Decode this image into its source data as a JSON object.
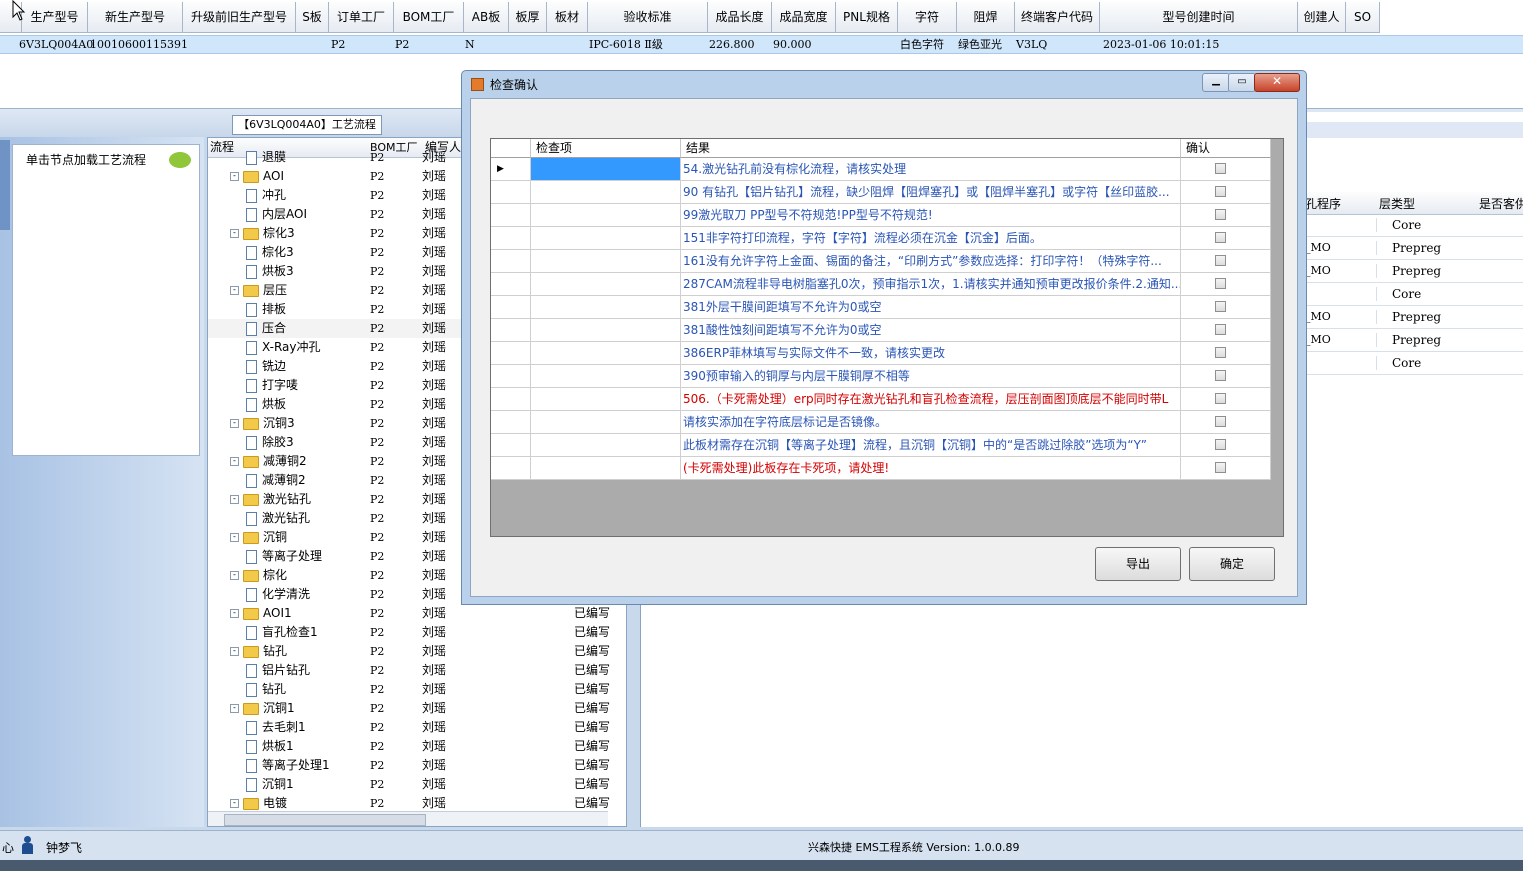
{
  "top_grid": {
    "headers": [
      "生产型号",
      "新生产型号",
      "升级前旧生产型号",
      "S板",
      "订单工厂",
      "BOM工厂",
      "AB板",
      "板厚",
      "板材",
      "验收标准",
      "成品长度",
      "成品宽度",
      "PNL规格",
      "字符",
      "阻焊",
      "终端客户代码",
      "型号创建时间",
      "创建人",
      "SO"
    ],
    "row": {
      "生产型号": "6V3LQ004A0",
      "新生产型号": "10010600115391",
      "订单工厂": "P2",
      "BOM工厂": "P2",
      "AB板": "N",
      "验收标准": "IPC-6018 Ⅱ级",
      "成品长度": "226.800",
      "成品宽度": "90.000",
      "字符": "白色字符",
      "阻焊": "绿色亚光",
      "终端客户代码": "V3LQ",
      "型号创建时间": "2023-01-06 10:01:15"
    }
  },
  "process_title": "【6V3LQ004A0】工艺流程",
  "left_panel": {
    "node_hint": "单击节点加载工艺流程"
  },
  "tree": {
    "headers": [
      "流程",
      "BOM工厂",
      "编写人"
    ],
    "rows": [
      {
        "type": "doc",
        "name": "退膜",
        "factory": "P2",
        "writer": "刘瑶",
        "status": ""
      },
      {
        "type": "folder",
        "name": "AOI",
        "factory": "P2",
        "writer": "刘瑶",
        "status": ""
      },
      {
        "type": "doc",
        "name": "冲孔",
        "factory": "P2",
        "writer": "刘瑶",
        "status": ""
      },
      {
        "type": "doc",
        "name": "内层AOI",
        "factory": "P2",
        "writer": "刘瑶",
        "status": ""
      },
      {
        "type": "folder",
        "name": "棕化3",
        "factory": "P2",
        "writer": "刘瑶",
        "status": ""
      },
      {
        "type": "doc",
        "name": "棕化3",
        "factory": "P2",
        "writer": "刘瑶",
        "status": ""
      },
      {
        "type": "doc",
        "name": "烘板3",
        "factory": "P2",
        "writer": "刘瑶",
        "status": ""
      },
      {
        "type": "folder",
        "name": "层压",
        "factory": "P2",
        "writer": "刘瑶",
        "status": ""
      },
      {
        "type": "doc",
        "name": "排板",
        "factory": "P2",
        "writer": "刘瑶",
        "status": ""
      },
      {
        "type": "doc",
        "name": "压合",
        "factory": "P2",
        "writer": "刘瑶",
        "status": ""
      },
      {
        "type": "doc",
        "name": "X-Ray冲孔",
        "factory": "P2",
        "writer": "刘瑶",
        "status": ""
      },
      {
        "type": "doc",
        "name": "铣边",
        "factory": "P2",
        "writer": "刘瑶",
        "status": ""
      },
      {
        "type": "doc",
        "name": "打字唛",
        "factory": "P2",
        "writer": "刘瑶",
        "status": ""
      },
      {
        "type": "doc",
        "name": "烘板",
        "factory": "P2",
        "writer": "刘瑶",
        "status": ""
      },
      {
        "type": "folder",
        "name": "沉铜3",
        "factory": "P2",
        "writer": "刘瑶",
        "status": ""
      },
      {
        "type": "doc",
        "name": "除胶3",
        "factory": "P2",
        "writer": "刘瑶",
        "status": ""
      },
      {
        "type": "folder",
        "name": "减薄铜2",
        "factory": "P2",
        "writer": "刘瑶",
        "status": ""
      },
      {
        "type": "doc",
        "name": "减薄铜2",
        "factory": "P2",
        "writer": "刘瑶",
        "status": ""
      },
      {
        "type": "folder",
        "name": "激光钻孔",
        "factory": "P2",
        "writer": "刘瑶",
        "status": ""
      },
      {
        "type": "doc",
        "name": "激光钻孔",
        "factory": "P2",
        "writer": "刘瑶",
        "status": ""
      },
      {
        "type": "folder",
        "name": "沉铜",
        "factory": "P2",
        "writer": "刘瑶",
        "status": ""
      },
      {
        "type": "doc",
        "name": "等离子处理",
        "factory": "P2",
        "writer": "刘瑶",
        "status": ""
      },
      {
        "type": "folder",
        "name": "棕化",
        "factory": "P2",
        "writer": "刘瑶",
        "status": ""
      },
      {
        "type": "doc",
        "name": "化学清洗",
        "factory": "P2",
        "writer": "刘瑶",
        "status": ""
      },
      {
        "type": "folder",
        "name": "AOI1",
        "factory": "P2",
        "writer": "刘瑶",
        "status": "已编写"
      },
      {
        "type": "doc",
        "name": "盲孔检查1",
        "factory": "P2",
        "writer": "刘瑶",
        "status": "已编写"
      },
      {
        "type": "folder",
        "name": "钻孔",
        "factory": "P2",
        "writer": "刘瑶",
        "status": "已编写"
      },
      {
        "type": "doc",
        "name": "铝片钻孔",
        "factory": "P2",
        "writer": "刘瑶",
        "status": "已编写"
      },
      {
        "type": "doc",
        "name": "钻孔",
        "factory": "P2",
        "writer": "刘瑶",
        "status": "已编写"
      },
      {
        "type": "folder",
        "name": "沉铜1",
        "factory": "P2",
        "writer": "刘瑶",
        "status": "已编写"
      },
      {
        "type": "doc",
        "name": "去毛刺1",
        "factory": "P2",
        "writer": "刘瑶",
        "status": "已编写"
      },
      {
        "type": "doc",
        "name": "烘板1",
        "factory": "P2",
        "writer": "刘瑶",
        "status": "已编写"
      },
      {
        "type": "doc",
        "name": "等离子处理1",
        "factory": "P2",
        "writer": "刘瑶",
        "status": "已编写"
      },
      {
        "type": "doc",
        "name": "沉铜1",
        "factory": "P2",
        "writer": "刘瑶",
        "status": "已编写"
      },
      {
        "type": "folder",
        "name": "电镀",
        "factory": "P2",
        "writer": "刘瑶",
        "status": "已编写"
      }
    ]
  },
  "right_grid": {
    "headers": [
      "孔程序",
      "层类型",
      "是否客供"
    ],
    "rows": [
      {
        "prog": "",
        "layer": "Core"
      },
      {
        "prog": "_MO",
        "layer": "Prepreg"
      },
      {
        "prog": "_MO",
        "layer": "Prepreg"
      },
      {
        "prog": "",
        "layer": "Core"
      },
      {
        "prog": "_MO",
        "layer": "Prepreg"
      },
      {
        "prog": "_MO",
        "layer": "Prepreg"
      },
      {
        "prog": "",
        "layer": "Core"
      }
    ]
  },
  "dialog": {
    "title": "检查确认",
    "headers": [
      "检查项",
      "结果",
      "确认"
    ],
    "rows": [
      {
        "result": "54.激光钻孔前没有棕化流程，请核实处理",
        "red": false
      },
      {
        "result": "90 有钻孔【铝片钻孔】流程，缺少阻焊【阻焊塞孔】或【阻焊半塞孔】或字符【丝印蓝胶...",
        "red": false
      },
      {
        "result": "99激光取刀 PP型号不符规范!PP型号不符规范!",
        "red": false
      },
      {
        "result": "151非字符打印流程，字符【字符】流程必须在沉金【沉金】后面。",
        "red": false
      },
      {
        "result": "161没有允许字符上金面、锡面的备注，“印刷方式”参数应选择：打印字符！（特殊字符...",
        "red": false
      },
      {
        "result": "287CAM流程非导电树脂塞孔0次，预审指示1次，1.请核实并通知预审更改报价条件.2.通知...",
        "red": false
      },
      {
        "result": "381外层干膜间距填写不允许为0或空",
        "red": false
      },
      {
        "result": "381酸性蚀刻间距填写不允许为0或空",
        "red": false
      },
      {
        "result": "386ERP菲林填写与实际文件不一致，请核实更改",
        "red": false
      },
      {
        "result": "390预审输入的铜厚与内层干膜铜厚不相等",
        "red": false
      },
      {
        "result": "506.（卡死需处理）erp同时存在激光钻孔和盲孔检查流程，层压剖面图顶底层不能同时带L",
        "red": true
      },
      {
        "result": "请核实添加在字符底层标记是否镜像。",
        "red": false
      },
      {
        "result": "此板材需存在沉铜【等离子处理】流程，且沉铜【沉铜】中的“是否跳过除胶”选项为“Y”",
        "red": false
      },
      {
        "result": "(卡死需处理)此板存在卡死项，请处理!",
        "red": true
      }
    ],
    "export_label": "导出",
    "ok_label": "确定"
  },
  "status_bar": {
    "left_text": "心",
    "user": "钟梦飞",
    "system": "兴森快捷 EMS工程系统 Version: 1.0.0.89"
  },
  "colors": {
    "link_blue": "#2a55b5",
    "error_red": "#d40000",
    "selection": "#3399ff"
  }
}
